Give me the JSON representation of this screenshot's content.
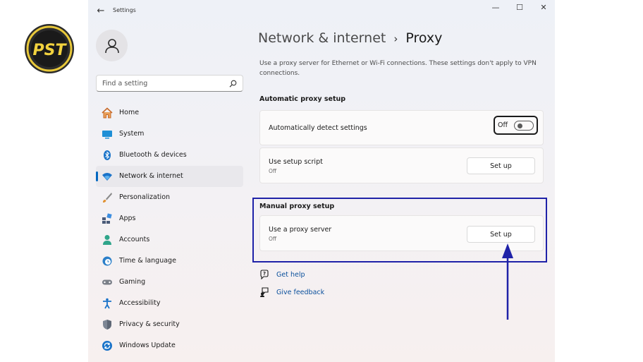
{
  "logo": {
    "text": "PST"
  },
  "titlebar": {
    "app_title": "Settings",
    "minimize": "—",
    "maximize": "☐",
    "close": "✕"
  },
  "sidebar": {
    "search": {
      "placeholder": "Find a setting"
    },
    "items": [
      {
        "label": "Home",
        "icon": "home-icon"
      },
      {
        "label": "System",
        "icon": "system-icon"
      },
      {
        "label": "Bluetooth & devices",
        "icon": "bluetooth-icon"
      },
      {
        "label": "Network & internet",
        "icon": "wifi-icon",
        "active": true
      },
      {
        "label": "Personalization",
        "icon": "brush-icon"
      },
      {
        "label": "Apps",
        "icon": "apps-icon"
      },
      {
        "label": "Accounts",
        "icon": "accounts-icon"
      },
      {
        "label": "Time & language",
        "icon": "time-language-icon"
      },
      {
        "label": "Gaming",
        "icon": "gaming-icon"
      },
      {
        "label": "Accessibility",
        "icon": "accessibility-icon"
      },
      {
        "label": "Privacy & security",
        "icon": "shield-icon"
      },
      {
        "label": "Windows Update",
        "icon": "windows-update-icon"
      }
    ]
  },
  "main": {
    "breadcrumb": {
      "parent": "Network & internet",
      "separator": "›",
      "current": "Proxy"
    },
    "description": "Use a proxy server for Ethernet or Wi-Fi connections. These settings don't apply to VPN connections.",
    "automatic": {
      "title": "Automatic proxy setup",
      "detect_label": "Automatically detect settings",
      "detect_state": "Off",
      "detect_on": false,
      "script_label": "Use setup script",
      "script_state": "Off",
      "script_button": "Set up"
    },
    "manual": {
      "title": "Manual proxy setup",
      "proxy_label": "Use a proxy server",
      "proxy_state": "Off",
      "proxy_button": "Set up"
    },
    "links": {
      "help": "Get help",
      "feedback": "Give feedback"
    }
  },
  "colors": {
    "accent": "#0067c0",
    "annotation": "#1f22a8",
    "link": "#0a4f9c"
  }
}
